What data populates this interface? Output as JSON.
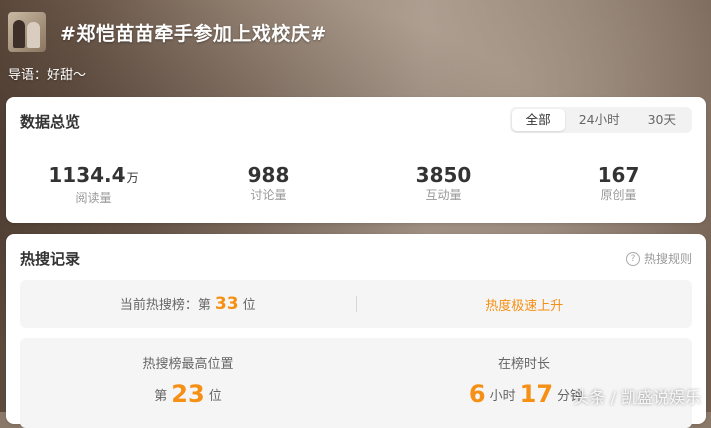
{
  "header": {
    "title": "#郑恺苗苗牵手参加上戏校庆#",
    "guide": "导语：好甜～"
  },
  "overview": {
    "title": "数据总览",
    "tabs": [
      "全部",
      "24小时",
      "30天"
    ],
    "active_tab": "全部",
    "stats": [
      {
        "value": "1134.4",
        "unit": "万",
        "label": "阅读量"
      },
      {
        "value": "988",
        "unit": "",
        "label": "讨论量"
      },
      {
        "value": "3850",
        "unit": "",
        "label": "互动量"
      },
      {
        "value": "167",
        "unit": "",
        "label": "原创量"
      }
    ]
  },
  "hot": {
    "title": "热搜记录",
    "rule_link": "热搜规则",
    "current": {
      "prefix": "当前热搜榜：第",
      "rank": "33",
      "suffix": "位"
    },
    "trend": "热度极速上升",
    "highest": {
      "label": "热搜榜最高位置",
      "prefix": "第",
      "rank": "23",
      "suffix": "位"
    },
    "duration": {
      "label": "在榜时长",
      "hours": "6",
      "hours_unit": "小时",
      "minutes": "17",
      "minutes_unit": "分钟"
    }
  },
  "watermark": "头条 / 凯盛说娱乐",
  "colors": {
    "accent": "#f59014"
  }
}
